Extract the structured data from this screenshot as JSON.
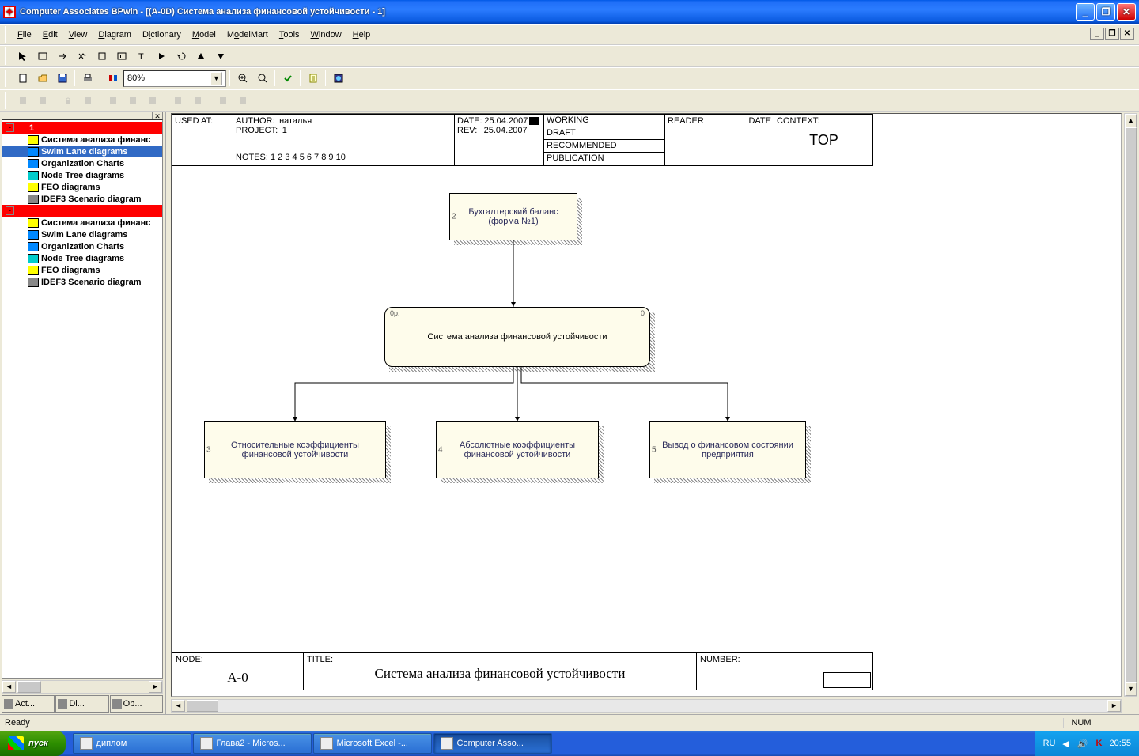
{
  "window": {
    "title": "Computer Associates BPwin - [(A-0D) Система анализа финансовой устойчивости - 1]"
  },
  "menu": {
    "file": "File",
    "edit": "Edit",
    "view": "View",
    "diagram": "Diagram",
    "dictionary": "Dictionary",
    "model": "Model",
    "modelmart": "ModelMart",
    "tools": "Tools",
    "window": "Window",
    "help": "Help"
  },
  "zoom": "80%",
  "tree": {
    "items": [
      {
        "level": 0,
        "pm": "-",
        "icon": "red",
        "label": "1",
        "style": "redrow"
      },
      {
        "level": 1,
        "icon": "yel",
        "label": "Система анализа финанс"
      },
      {
        "level": 1,
        "icon": "blu",
        "label": "Swim Lane diagrams",
        "style": "sel"
      },
      {
        "level": 1,
        "icon": "blu",
        "label": "Organization Charts"
      },
      {
        "level": 1,
        "icon": "cyn",
        "label": "Node Tree diagrams"
      },
      {
        "level": 1,
        "icon": "yel",
        "label": "FEO diagrams"
      },
      {
        "level": 1,
        "icon": "gray",
        "label": "IDEF3 Scenario diagram"
      },
      {
        "level": 0,
        "pm": "-",
        "icon": "red",
        "label": "",
        "style": "redrow"
      },
      {
        "level": 1,
        "icon": "yel",
        "label": "Система анализа финанс"
      },
      {
        "level": 1,
        "icon": "blu",
        "label": "Swim Lane diagrams"
      },
      {
        "level": 1,
        "icon": "blu",
        "label": "Organization Charts"
      },
      {
        "level": 1,
        "icon": "cyn",
        "label": "Node Tree diagrams"
      },
      {
        "level": 1,
        "icon": "yel",
        "label": "FEO diagrams"
      },
      {
        "level": 1,
        "icon": "gray",
        "label": "IDEF3 Scenario diagram"
      }
    ]
  },
  "side_tabs": {
    "t1": "Act...",
    "t2": "Di...",
    "t3": "Ob..."
  },
  "header": {
    "used_at": "USED AT:",
    "author_lbl": "AUTHOR:",
    "author": "наталья",
    "project_lbl": "PROJECT:",
    "project": "1",
    "notes": "NOTES: 1 2 3 4 5 6 7 8 9 10",
    "date_lbl": "DATE:",
    "date": "25.04.2007",
    "rev_lbl": "REV:",
    "rev": "25.04.2007",
    "working": "WORKING",
    "draft": "DRAFT",
    "recommended": "RECOMMENDED",
    "publication": "PUBLICATION",
    "reader": "READER",
    "r_date": "DATE",
    "context": "CONTEXT:",
    "top": "TOP"
  },
  "nodes": {
    "n1": {
      "idx": "2",
      "text": "Бухгалтерский баланс (форма №1)"
    },
    "n2": {
      "idx": "0p.",
      "text": "Система анализа финансовой устойчивости",
      "corner": "0"
    },
    "n3": {
      "idx": "3",
      "text": "Относительные коэффициенты финансовой устойчивости"
    },
    "n4": {
      "idx": "4",
      "text": "Абсолютные коэффициенты финансовой устойчивости"
    },
    "n5": {
      "idx": "5",
      "text": "Вывод о финансовом состоянии предприятия"
    }
  },
  "footer": {
    "node_lbl": "NODE:",
    "node": "A-0",
    "title_lbl": "TITLE:",
    "title": "Система анализа финансовой устойчивости",
    "number_lbl": "NUMBER:"
  },
  "status": {
    "ready": "Ready",
    "num": "NUM"
  },
  "taskbar": {
    "start": "пуск",
    "items": [
      {
        "label": "диплом"
      },
      {
        "label": "Глава2 - Micros..."
      },
      {
        "label": "Microsoft Excel -..."
      },
      {
        "label": "Computer Asso...",
        "active": true
      }
    ],
    "lang": "RU",
    "time": "20:55"
  }
}
